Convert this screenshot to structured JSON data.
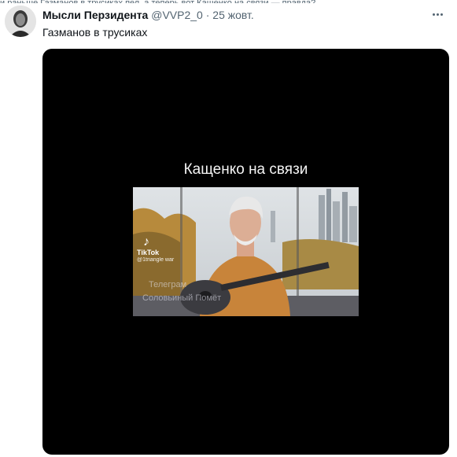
{
  "top_strip_text": "и раньше Газманов в трусиках пел, а теперь вот Кащенко на связи — правда?",
  "tweet": {
    "author_name": "Мысли Перзидента",
    "author_handle": "@VVP2_0",
    "separator": "·",
    "date": "25 жовт.",
    "text": "Газманов в трусиках"
  },
  "media": {
    "caption": "Кащенко на связи",
    "tiktok_logo": "♪",
    "tiktok_label": "TikTok",
    "tiktok_user": "@1triangle war",
    "watermark_line1": "Телеграм",
    "watermark_line2": "Соловьиный Помёт"
  },
  "icons": {
    "avatar": "avatar-portrait-icon",
    "more": "more-options-icon"
  }
}
